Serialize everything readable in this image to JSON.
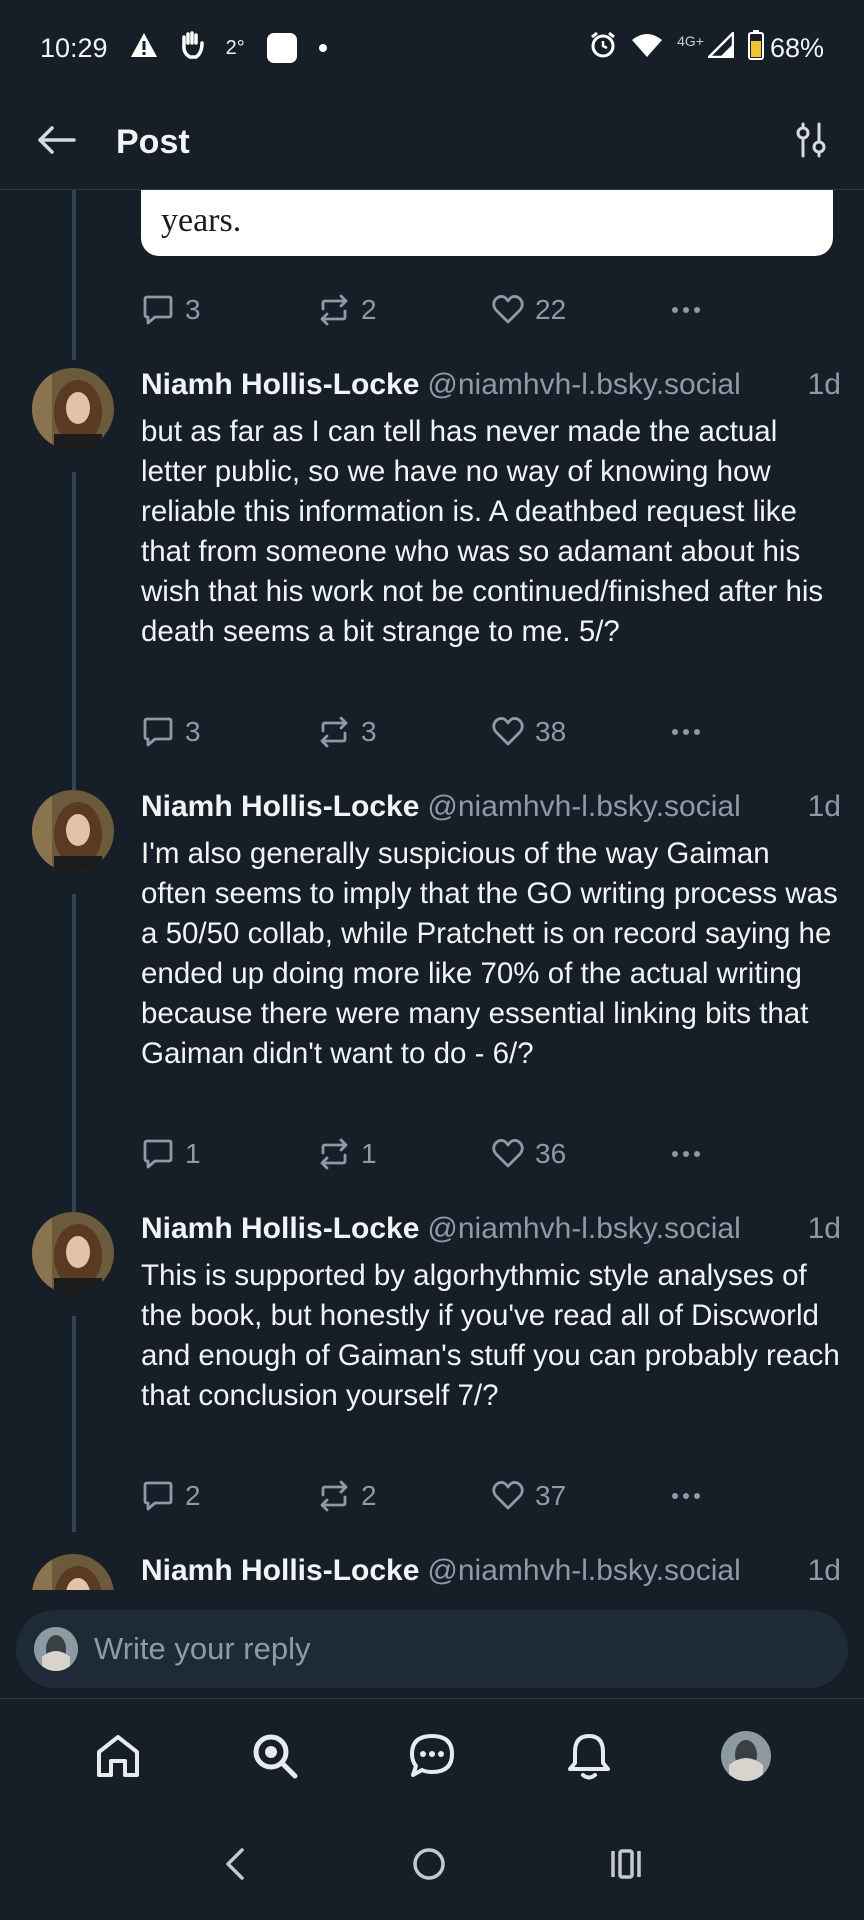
{
  "status_bar": {
    "time": "10:29",
    "temperature": "2°",
    "network": "4G+",
    "battery": "68%"
  },
  "header": {
    "title": "Post"
  },
  "quoted_card": {
    "text": "years."
  },
  "first_actions": {
    "replies": "3",
    "reposts": "2",
    "likes": "22"
  },
  "posts": [
    {
      "name": "Niamh Hollis-Locke",
      "handle": "@niamhvh-l.bsky.social",
      "time": "1d",
      "text": "but as far as I can tell has never made the actual letter public, so we have no way of knowing how reliable this information is. A deathbed request like that from someone who was so adamant about his wish that his work not be continued/finished after his death seems a bit strange to me. 5/?",
      "replies": "3",
      "reposts": "3",
      "likes": "38"
    },
    {
      "name": "Niamh Hollis-Locke",
      "handle": "@niamhvh-l.bsky.social",
      "time": "1d",
      "text": "I'm also generally suspicious of the way Gaiman often seems to imply that the GO writing process was a 50/50 collab, while Pratchett is on record saying he ended up doing more like 70% of the actual writing because there were many essential linking bits that Gaiman didn't want to do - 6/?",
      "replies": "1",
      "reposts": "1",
      "likes": "36"
    },
    {
      "name": "Niamh Hollis-Locke",
      "handle": "@niamhvh-l.bsky.social",
      "time": "1d",
      "text": "This is supported by algorhythmic style analyses of the book, but honestly if you've read all of Discworld and enough of Gaiman's stuff you can probably reach that conclusion yourself 7/?",
      "replies": "2",
      "reposts": "2",
      "likes": "37"
    },
    {
      "name": "Niamh Hollis-Locke",
      "handle": "@niamhvh-l.bsky.social",
      "time": "1d"
    }
  ],
  "reply_box": {
    "placeholder": "Write your reply"
  },
  "colors": {
    "background": "#161e27",
    "accent_line": "#2e4559",
    "muted_text": "#8e9aa7"
  }
}
